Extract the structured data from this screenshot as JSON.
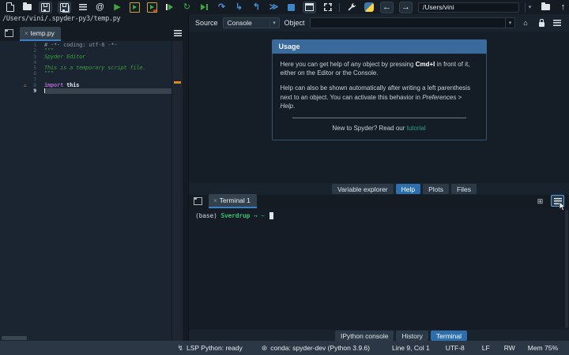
{
  "colors": {
    "accent_blue": "#3a699c",
    "selected_tab_blue": "#2d6fae",
    "run_green": "#3fa63f",
    "debug_blue": "#4b8fce",
    "warning_orange": "#e2a42c",
    "link_green": "#27a08b",
    "terminal_green": "#33c06e",
    "terminal_teal": "#1fb3a0",
    "keyword_purple": "#a964c7",
    "string_green": "#3c9b3c",
    "scrollflag_orange": "#d8861f"
  },
  "icons": {
    "at": "@",
    "run": "▶",
    "rerun": "↻",
    "step_over": "↷",
    "step_into": "↳",
    "step_return": "↰",
    "continue": "≫",
    "back": "←",
    "forward": "→",
    "up": "↑",
    "home": "⌂",
    "plus_box": "⊞",
    "warning": "⚠",
    "dropdown": "▾",
    "close": "×",
    "lsp": "↯",
    "conda": "⊛"
  },
  "toolbar": {
    "working_directory": "/Users/vini"
  },
  "path_bar": {
    "file_path": "/Users/vini/.spyder-py3/temp.py"
  },
  "editor": {
    "tab_label": "temp.py",
    "lines": [
      {
        "num": "1",
        "code": [
          {
            "c": "comment",
            "t": "# -*- coding: utf-8 -*-"
          }
        ]
      },
      {
        "num": "2",
        "code": [
          {
            "c": "string",
            "t": "\"\"\""
          }
        ]
      },
      {
        "num": "3",
        "code": [
          {
            "c": "string",
            "t": "Spyder Editor"
          }
        ]
      },
      {
        "num": "4",
        "code": []
      },
      {
        "num": "5",
        "code": [
          {
            "c": "string",
            "t": "This is a temporary script file."
          }
        ]
      },
      {
        "num": "6",
        "code": [
          {
            "c": "string",
            "t": "\"\"\""
          }
        ]
      },
      {
        "num": "7",
        "code": []
      },
      {
        "num": "8",
        "code": [
          {
            "c": "keyword",
            "t": "import"
          },
          {
            "c": "normal",
            "t": " this"
          }
        ]
      },
      {
        "num": "9",
        "code": []
      }
    ]
  },
  "help": {
    "source_label": "Source",
    "source_value": "Console",
    "object_label": "Object",
    "object_value": "",
    "usage": {
      "title": "Usage",
      "p1_pre": "Here you can get help of any object by pressing ",
      "p1_kbd": "Cmd+I",
      "p1_post": " in front of it, either on the Editor or the Console.",
      "p2_pre": "Help can also be shown automatically after writing a left parenthesis next to an object. You can activate this behavior in ",
      "p2_em": "Preferences > Help",
      "p2_post": ".",
      "footer_pre": "New to Spyder? Read our ",
      "footer_link": "tutorial"
    },
    "tabs": [
      "Variable explorer",
      "Help",
      "Plots",
      "Files"
    ],
    "active_tab": "Help"
  },
  "terminal": {
    "tab_label": "Terminal 1",
    "prompt": {
      "env": "(base)",
      "host": "Sverdrup",
      "arrow": "→",
      "cwd": "~"
    }
  },
  "bottom_tabs": {
    "tabs": [
      "IPython console",
      "History",
      "Terminal"
    ],
    "active_tab": "Terminal"
  },
  "status_bar": {
    "lsp": "LSP Python: ready",
    "conda": "conda: spyder-dev (Python 3.9.6)",
    "cursor_position": "Line 9, Col 1",
    "encoding": "UTF-8",
    "eol": "LF",
    "permissions": "RW",
    "memory": "Mem 75%"
  }
}
